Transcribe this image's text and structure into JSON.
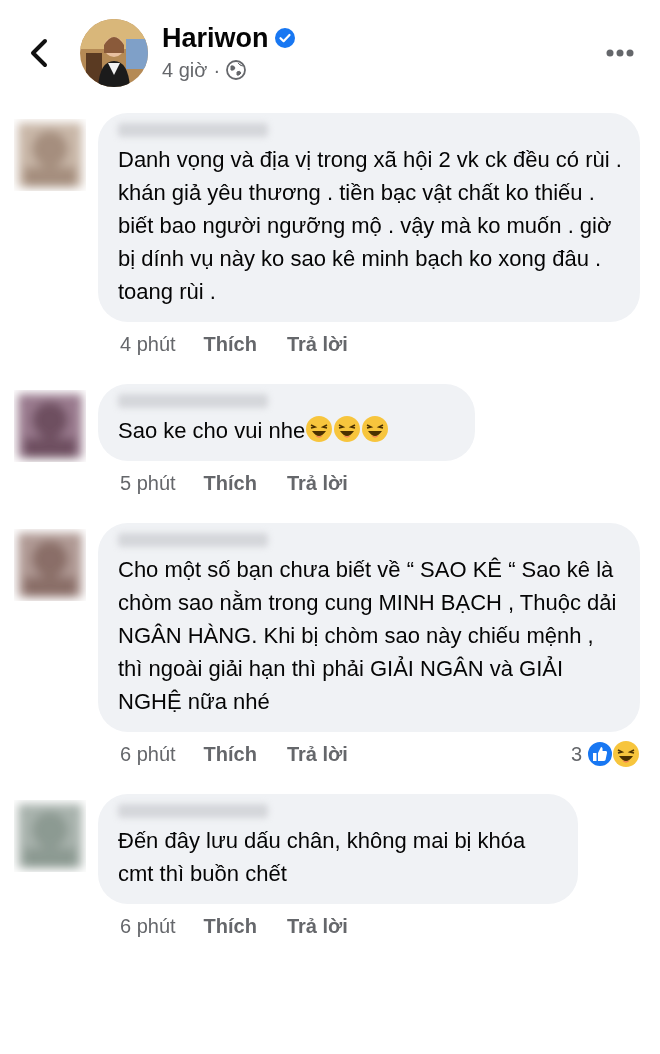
{
  "header": {
    "name": "Hariwon",
    "verified": true,
    "time": "4 giờ",
    "separator": "·"
  },
  "comments": [
    {
      "text": "Danh vọng và địa vị trong xã hội 2 vk ck đều có rùi . khán giả yêu thương . tiền bạc vật chất ko thiếu . biết bao người ngưỡng mộ . vậy mà ko muốn . giờ bị dính vụ này ko sao kê minh bạch ko xong đâu . toang rùi .",
      "time": "4 phút",
      "like": "Thích",
      "reply": "Trả lời"
    },
    {
      "text": "Sao ke cho vui nhe",
      "trailing_icons": [
        {
          "kind": "laughing"
        },
        {
          "kind": "laughing"
        },
        {
          "kind": "laughing"
        }
      ],
      "time": "5 phút",
      "like": "Thích",
      "reply": "Trả lời"
    },
    {
      "text": "Cho một số bạn chưa biết về “ SAO KÊ “ Sao kê là chòm sao nằm trong cung MINH BẠCH , Thuộc dải NGÂN HÀNG. Khi bị chòm sao này chiếu mệnh , thì ngoài giải hạn thì phải GIẢI NGÂN và GIẢI NGHỆ nữa nhé",
      "time": "6 phút",
      "like": "Thích",
      "reply": "Trả lời",
      "reactions": {
        "count": "3",
        "icons": [
          {
            "kind": "like"
          },
          {
            "kind": "haha"
          }
        ]
      }
    },
    {
      "text": "Đến đây lưu dấu chân, không mai bị khóa cmt thì buồn chết",
      "time": "6 phút",
      "like": "Thích",
      "reply": "Trả lời"
    }
  ]
}
